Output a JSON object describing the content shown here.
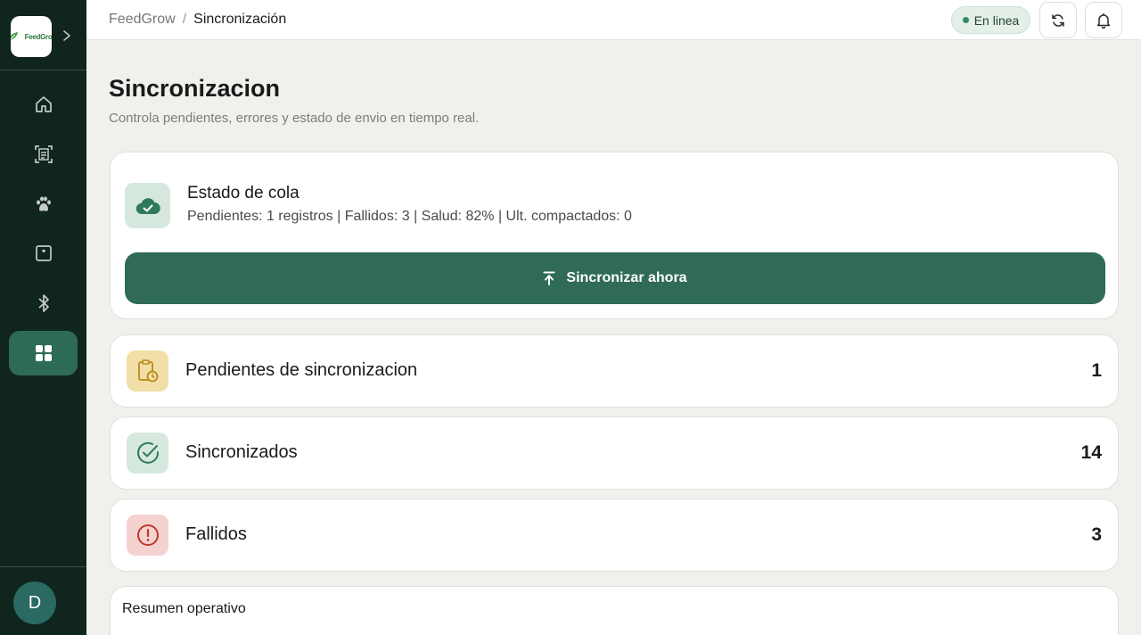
{
  "app": {
    "logo_text": "FeedGrow",
    "avatar_initial": "D"
  },
  "breadcrumb": {
    "root": "FeedGrow",
    "separator": "/",
    "current": "Sincronización"
  },
  "topbar": {
    "status_label": "En linea",
    "status_color": "#2e8b5a",
    "sync_icon": "refresh-icon",
    "notifications_icon": "bell-icon"
  },
  "sidebar": {
    "items": [
      {
        "icon": "home-icon"
      },
      {
        "icon": "scan-document-icon"
      },
      {
        "icon": "paw-icon"
      },
      {
        "icon": "scale-icon"
      },
      {
        "icon": "bluetooth-icon"
      },
      {
        "icon": "grid-icon",
        "active": true
      }
    ]
  },
  "page": {
    "title": "Sincronizacion",
    "subtitle": "Controla pendientes, errores y estado de envio en tiempo real."
  },
  "queue": {
    "title": "Estado de cola",
    "description": "Pendientes: 1 registros | Fallidos: 3 | Salud: 82% | Ult. compactados: 0",
    "sync_button": "Sincronizar ahora",
    "accent": "#2f6b57"
  },
  "stats": [
    {
      "label": "Pendientes de sincronizacion",
      "count": "1",
      "icon": "clipboard-clock-icon",
      "color": "#f2dfa7"
    },
    {
      "label": "Sincronizados",
      "count": "14",
      "icon": "check-circle-icon",
      "color": "#d6e8de"
    },
    {
      "label": "Fallidos",
      "count": "3",
      "icon": "alert-circle-icon",
      "color": "#f4d2cf"
    }
  ],
  "summary": {
    "title": "Resumen operativo"
  }
}
